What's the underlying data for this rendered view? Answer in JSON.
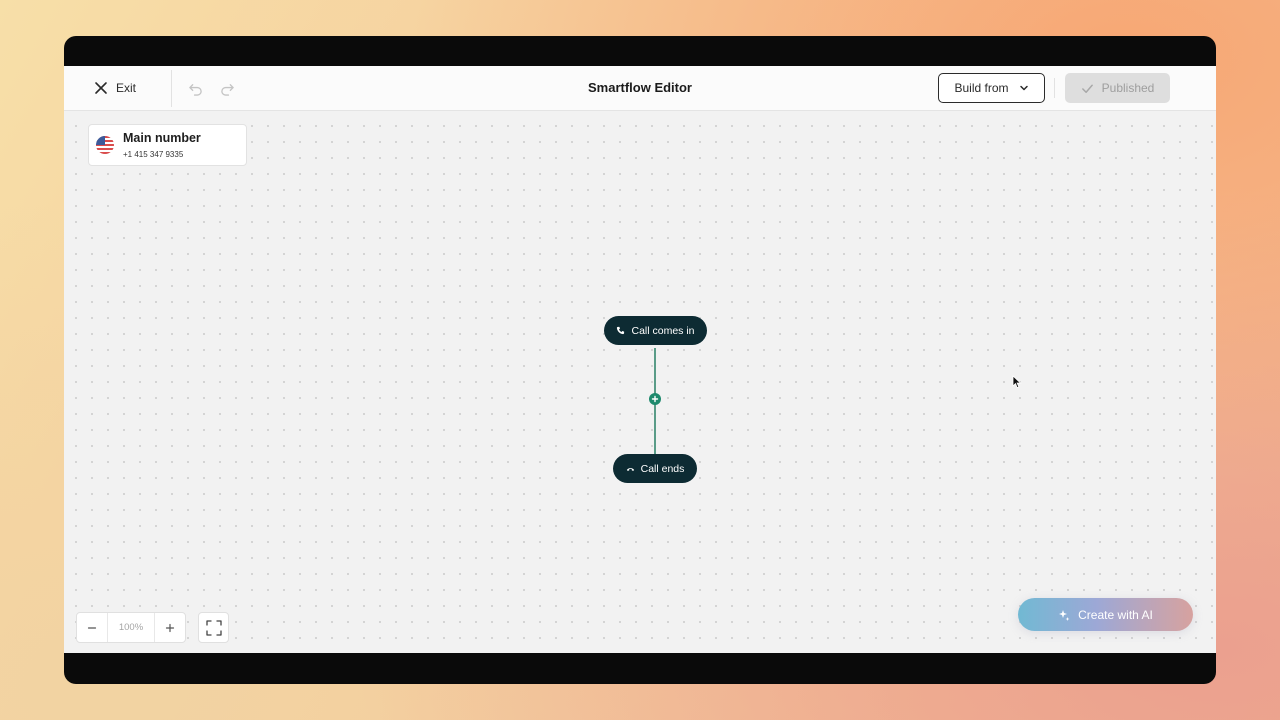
{
  "header": {
    "exit_label": "Exit",
    "title": "Smartflow Editor",
    "build_from_label": "Build from",
    "published_label": "Published"
  },
  "phone_card": {
    "title": "Main number",
    "number": "+1 415 347 9335",
    "flag": "us-flag"
  },
  "flow": {
    "start_label": "Call comes in",
    "end_label": "Call ends",
    "line_color": "#5a9c88",
    "add_color": "#1e8a6d",
    "node_color": "#0d2b33"
  },
  "zoom": {
    "level": "100%"
  },
  "ai": {
    "label": "Create with AI"
  }
}
